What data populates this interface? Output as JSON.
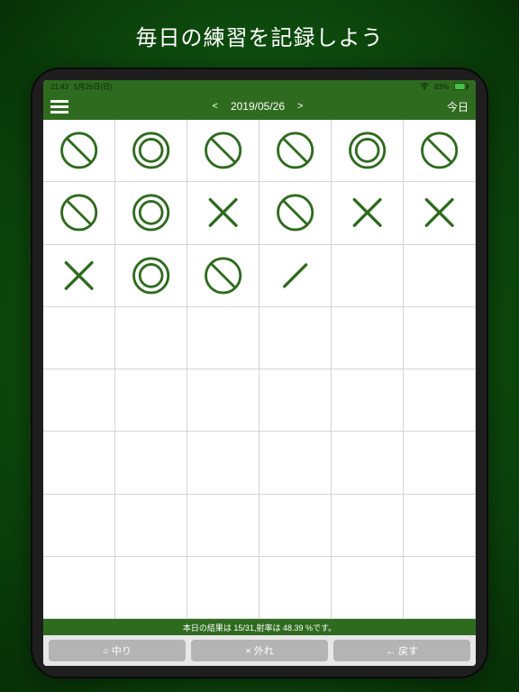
{
  "headline": "毎日の練習を記録しよう",
  "status": {
    "time": "21:43",
    "date": "5月26日(日)",
    "battery": "83%"
  },
  "nav": {
    "prev": "<",
    "date": "2019/05/26",
    "next": ">",
    "today": "今日"
  },
  "grid": {
    "cols": 6,
    "rows": 8,
    "cells": [
      "slash",
      "double",
      "slash",
      "slash",
      "double",
      "slash",
      "slash",
      "double",
      "x",
      "slash",
      "x",
      "x",
      "x",
      "double",
      "slash",
      "line",
      "",
      ""
    ]
  },
  "result": "本日の結果は 15/31,射率は 48.39 %です。",
  "buttons": {
    "hit": "○ 中り",
    "miss": "× 外れ",
    "undo": "← 戻す"
  },
  "colors": {
    "mark": "#2f6b1f"
  }
}
